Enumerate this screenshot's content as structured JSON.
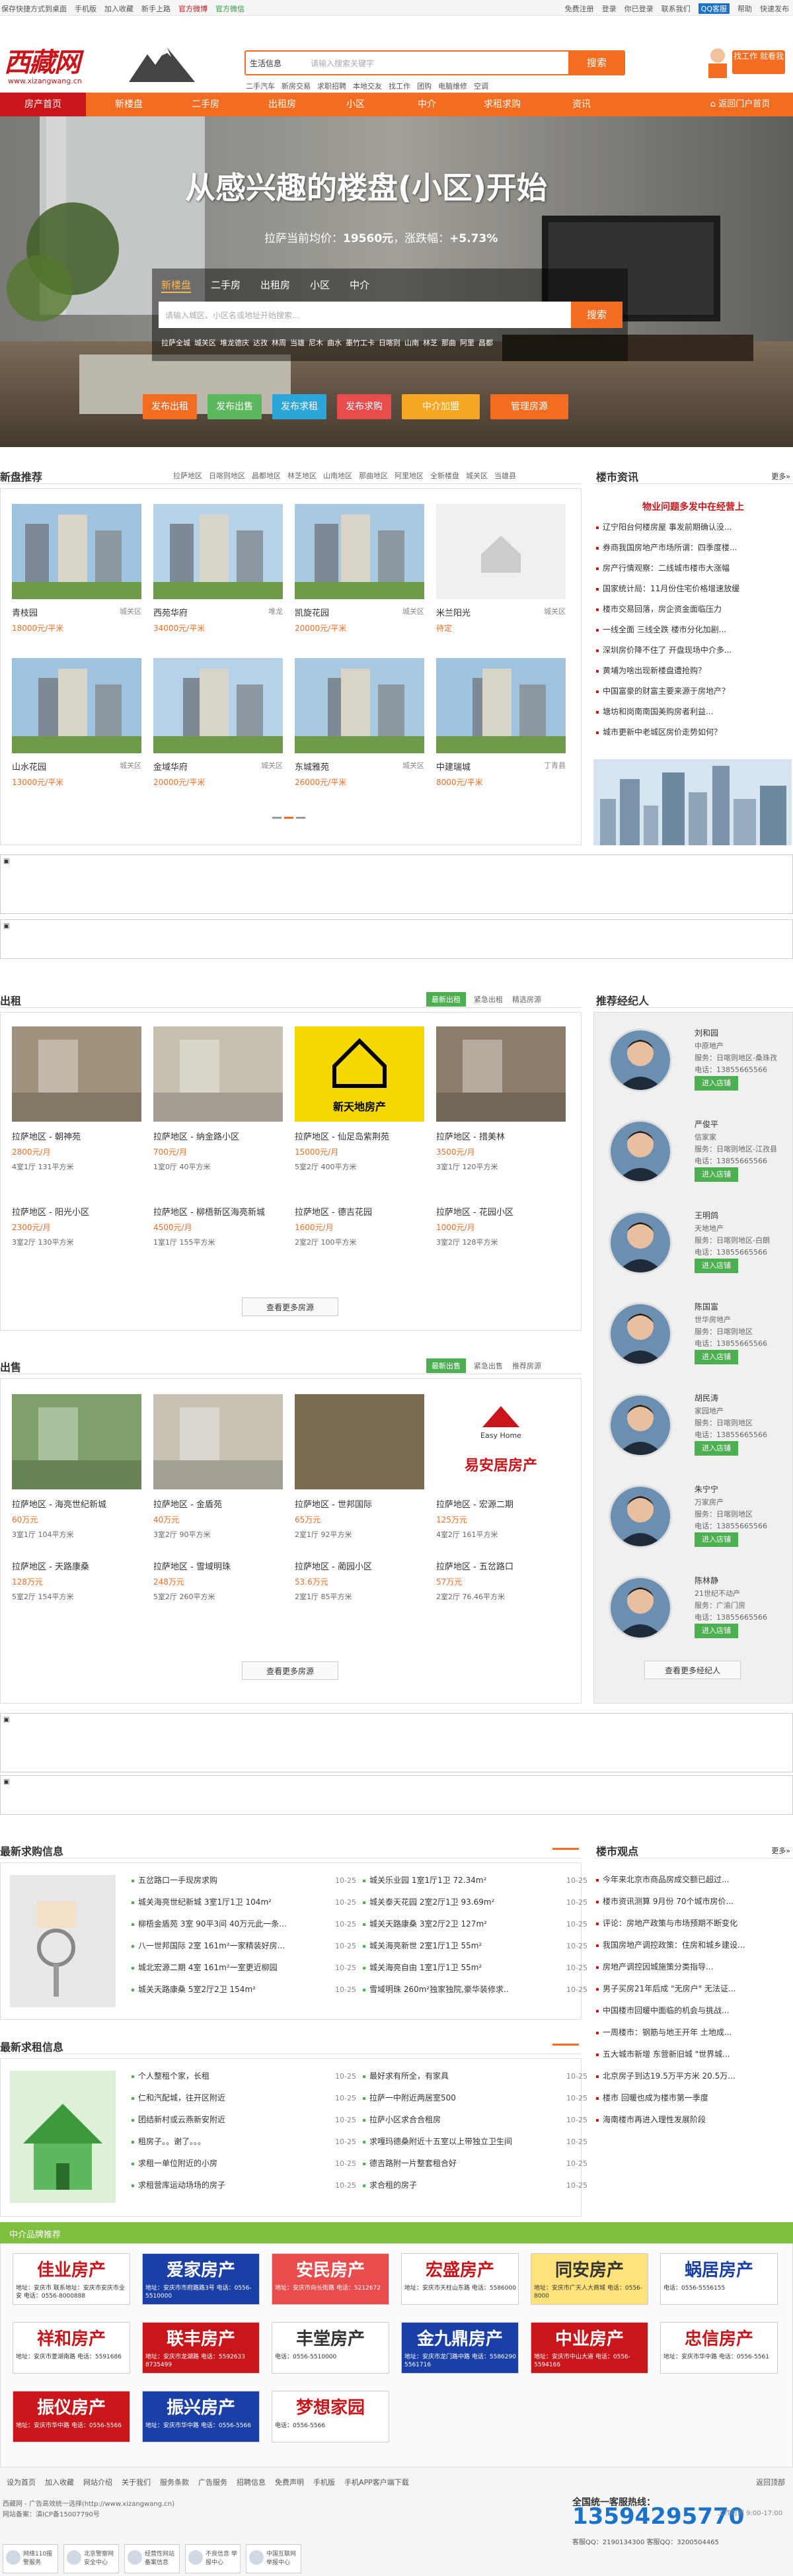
{
  "topbar": {
    "left": [
      "保存快捷方式到桌面",
      "手机版",
      "加入收藏",
      "新手上路",
      "官方微博",
      "官方微信"
    ],
    "right": [
      "免费注册",
      "登录",
      "你已登录",
      "联系我们",
      "QQ客服",
      "帮助",
      "快速发布"
    ]
  },
  "header": {
    "logo": "西藏网",
    "logo_sub": "www.xizangwang.cn",
    "search_category": "生活信息",
    "search_placeholder": "请输入搜索关键字",
    "search_button": "搜索",
    "hotlinks": [
      "二手汽车",
      "新房交易",
      "求职招聘",
      "本地交友",
      "找工作",
      "团购",
      "电脑维修",
      "空调"
    ],
    "promo": "找工作 就看我"
  },
  "nav": {
    "items": [
      "房产首页",
      "新楼盘",
      "二手房",
      "出租房",
      "小区",
      "中介",
      "求租求购",
      "资讯"
    ],
    "right": "返回门户首页"
  },
  "hero": {
    "title": "从感兴趣的楼盘(小区)开始",
    "price_text": "拉萨当前均价：",
    "price": "19560元",
    "rise_text": "，涨跌幅：",
    "rise": "+5.73%",
    "tabs": [
      "新楼盘",
      "二手房",
      "出租房",
      "小区",
      "中介"
    ],
    "input_placeholder": "请输入城区、小区名或地址开始搜索...",
    "search_button": "搜索",
    "areas": [
      "拉萨全城",
      "城关区",
      "堆龙德庆",
      "达孜",
      "林周",
      "当雄",
      "尼木",
      "曲水",
      "墨竹工卡",
      "日喀则",
      "山南",
      "林芝",
      "那曲",
      "阿里",
      "昌都"
    ],
    "buttons": [
      {
        "label": "发布出租",
        "color": "#f26d21"
      },
      {
        "label": "发布出售",
        "color": "#5cb85c"
      },
      {
        "label": "发布求租",
        "color": "#2aa7d8"
      },
      {
        "label": "发布求购",
        "color": "#e84c4c"
      },
      {
        "label": "中介加盟",
        "color": "#f5a623"
      },
      {
        "label": "管理房源",
        "color": "#f26d21"
      }
    ]
  },
  "newhouse": {
    "title": "新盘推荐",
    "tabs": [
      "拉萨地区",
      "日喀则地区",
      "昌都地区",
      "林芝地区",
      "山南地区",
      "那曲地区",
      "阿里地区",
      "全新楼盘",
      "城关区",
      "当雄县"
    ],
    "cards": [
      {
        "name": "青枝园",
        "area": "城关区",
        "price": "18000元/平米"
      },
      {
        "name": "西苑华府",
        "area": "堆龙",
        "price": "34000元/平米"
      },
      {
        "name": "凯旋花园",
        "area": "城关区",
        "price": "20000元/平米"
      },
      {
        "name": "米兰阳光",
        "area": "城关区",
        "price": "待定"
      },
      {
        "name": "山水花园",
        "area": "城关区",
        "price": "13000元/平米"
      },
      {
        "name": "金域华府",
        "area": "城关区",
        "price": "20000元/平米"
      },
      {
        "name": "东城雅苑",
        "area": "城关区",
        "price": "26000元/平米"
      },
      {
        "name": "中建瑞城",
        "area": "丁青县",
        "price": "8000元/平米"
      }
    ]
  },
  "news": {
    "title": "楼市资讯",
    "more": "更多»",
    "headline": "物业问题多发中在经营上",
    "items": [
      "辽宁阳台何楼房屋 事发前期确认没...",
      "券商我国房地产市场所谓：四季度楼...",
      "房产行情观察：二线城市楼市大涨幅",
      "国家统计局：11月份住宅价格增速放缓",
      "楼市交易回落，房企资金面临压力",
      "一线全面 三线全跌 楼市分化加剧...",
      "深圳房价降不住了 开盘现场中介多...",
      "黄埔为啥出现新楼盘遭抢购？",
      "中国富豪的财富主要来源于房地产？",
      "塘坊和岗南南国美购房者利益...",
      "城市更新中老城区房价走势如何？"
    ]
  },
  "rent": {
    "title": "出租",
    "tabs": [
      "最新出租",
      "紧急出租",
      "精选房源"
    ],
    "cards": [
      {
        "title": "拉萨地区 - 朝神苑",
        "price": "2800元/月",
        "detail": "4室1厅 131平方米"
      },
      {
        "title": "拉萨地区 - 纳金路小区",
        "price": "700元/月",
        "detail": "1室0厅 40平方米"
      },
      {
        "title": "拉萨地区 - 仙足岛紫荆苑",
        "price": "15000元/月",
        "detail": "5室2厅 400平方米"
      },
      {
        "title": "拉萨地区 - 措美林",
        "price": "3500元/月",
        "detail": "3室1厅 120平方米"
      },
      {
        "title": "拉萨地区 - 阳光小区",
        "price": "2300元/月",
        "detail": "3室2厅 130平方米"
      },
      {
        "title": "拉萨地区 - 柳梧新区海亮新城",
        "price": "4500元/月",
        "detail": "1室1厅 155平方米"
      },
      {
        "title": "拉萨地区 - 德吉花园",
        "price": "1600元/月",
        "detail": "2室2厅 100平方米"
      },
      {
        "title": "拉萨地区 - 花园小区",
        "price": "1000元/月",
        "detail": "3室2厅 128平方米"
      }
    ],
    "more": "查看更多房源",
    "logo": "新天地房产"
  },
  "sale": {
    "title": "出售",
    "tabs": [
      "最新出售",
      "紧急出售",
      "推荐房源"
    ],
    "cards": [
      {
        "title": "拉萨地区 - 海亮世纪新城",
        "price": "60万元",
        "detail": "3室1厅 104平方米"
      },
      {
        "title": "拉萨地区 - 金盾苑",
        "price": "40万元",
        "detail": "3室2厅 90平方米"
      },
      {
        "title": "拉萨地区 - 世邦国际",
        "price": "65万元",
        "detail": "2室1厅 92平方米"
      },
      {
        "title": "拉萨地区 - 宏源二期",
        "price": "125万元",
        "detail": "4室2厅 161平方米"
      },
      {
        "title": "拉萨地区 - 天路康桑",
        "price": "128万元",
        "detail": "5室2厅 154平方米"
      },
      {
        "title": "拉萨地区 - 雪域明珠",
        "price": "248万元",
        "detail": "5室2厅 260平方米"
      },
      {
        "title": "拉萨地区 - 蔺园小区",
        "price": "53.6万元",
        "detail": "2室1厅 85平方米"
      },
      {
        "title": "拉萨地区 - 五岔路口",
        "price": "57万元",
        "detail": "2室2厅 76.46平方米"
      }
    ],
    "more": "查看更多房源",
    "logo": "易安居房产",
    "logo_en": "Easy Home"
  },
  "agents": {
    "title": "推荐经纪人",
    "button": "进入店铺",
    "more": "查看更多经纪人",
    "list": [
      {
        "name": "刘和园",
        "company": "中原地产",
        "area": "服务：日喀则地区-桑珠孜",
        "phone": "电话：13855665566"
      },
      {
        "name": "严俊平",
        "company": "信家家",
        "area": "服务：日喀则地区-江孜县",
        "phone": "电话：13855665566"
      },
      {
        "name": "王明鸽",
        "company": "天地地产",
        "area": "服务：日喀则地区-白朗",
        "phone": "电话：13855665566"
      },
      {
        "name": "陈国富",
        "company": "世华房地产",
        "area": "服务：日喀则地区",
        "phone": "电话：13855665566"
      },
      {
        "name": "胡民涛",
        "company": "家园地产",
        "area": "服务：日喀则地区",
        "phone": "电话：13855665566"
      },
      {
        "name": "朱宁宁",
        "company": "万家房产",
        "area": "服务：日喀则地区",
        "phone": "电话：13855665566"
      },
      {
        "name": "陈林静",
        "company": "21世纪不动产",
        "area": "服务：广渝门房",
        "phone": "电话：13855665566"
      }
    ]
  },
  "buy": {
    "title": "最新求购信息",
    "left": [
      {
        "t": "五岔路口一手现房求购",
        "d": "10-25"
      },
      {
        "t": "城关海亮世纪新城 3室1厅1卫 104m²",
        "d": "10-25"
      },
      {
        "t": "柳梧金盾苑 3室 90平3间 40万元此一条...",
        "d": "10-25"
      },
      {
        "t": "八一世邦国际 2室 161m²一家精装好房...",
        "d": "10-25"
      },
      {
        "t": "城北宏源二期 4室 161m²一室更近柳园 ",
        "d": "10-25"
      },
      {
        "t": "城关天路康桑 5室2厅2卫 154m²",
        "d": "10-25"
      }
    ],
    "right": [
      {
        "t": "城关乐业园 1室1厅1卫 72.34m²",
        "d": "10-25"
      },
      {
        "t": "城关泰天花园 2室2厅1卫 93.69m²",
        "d": "10-25"
      },
      {
        "t": "城关天路康桑 3室2厅2卫 127m²",
        "d": "10-25"
      },
      {
        "t": "城关海亮新世 2室1厅1卫 55m²",
        "d": "10-25"
      },
      {
        "t": "城关海亮自由 1室1厅1卫 55m²",
        "d": "10-25"
      },
      {
        "t": "雪域明珠 260m²独家独院,豪华装修求..",
        "d": "10-25"
      }
    ]
  },
  "view": {
    "title": "楼市观点",
    "more": "更多»",
    "items": [
      "今年来北京市商品房成交额已超过...",
      "楼市资讯测算 9月份 70个城市房价...",
      "评论：房地产政策与市场预期不断变化",
      "我国房地产调控政策：住房和城乡建设...",
      "房地产调控因城施策分类指导...",
      "男子买房21年后成 \"无房户\" 无法证...",
      "中国楼市回暖中面临的机会与挑战...",
      "一周楼市：钢筋与地王开年 土地成...",
      "五大城市新增 东营新旧城 \"世界城...",
      "北京房子到达19.5万平方米 20.5万...",
      "楼市 回暖也成为楼市第一季度",
      "海南楼市再进入理性发展阶段"
    ]
  },
  "rentreq": {
    "title": "最新求租信息",
    "left": [
      {
        "t": "个人整租个家，长租",
        "d": "10-25"
      },
      {
        "t": "仁和汽配城，往开区附近",
        "d": "10-25"
      },
      {
        "t": "团结新村或云燕新安附近",
        "d": "10-25"
      },
      {
        "t": "租房子。。谢了。。。",
        "d": "10-25"
      },
      {
        "t": "求租一单位附近的小房",
        "d": "10-25"
      },
      {
        "t": "求租营库运动场场的房子",
        "d": "10-25"
      }
    ],
    "right": [
      {
        "t": "最好求有所全，有家具",
        "d": "10-25"
      },
      {
        "t": "拉萨一中附近两居室500",
        "d": "10-25"
      },
      {
        "t": "拉萨小区求合合租房",
        "d": "10-25"
      },
      {
        "t": "求嘎玛德桑附近十五室以上带独立卫生间",
        "d": "10-25"
      },
      {
        "t": "德吉路附一片整套租合好",
        "d": "10-25"
      },
      {
        "t": "求合租的房子",
        "d": "10-25"
      }
    ]
  },
  "brands": {
    "title": "中介品牌推荐",
    "list": [
      {
        "name": "佳业房产",
        "color": "#c9161b",
        "bg": "#fff",
        "info": "地址：安庆市 联系地址：安庆市安庆市业安 电话：0556-8000888"
      },
      {
        "name": "爱家房产",
        "color": "#fff",
        "bg": "#1a3fa6",
        "info": "地址：安庆市市府路路3号 电话：0556-5510000"
      },
      {
        "name": "安民房产",
        "color": "#fff",
        "bg": "#e84c4c",
        "info": "地址：安庆市向长街路 电话：5212672"
      },
      {
        "name": "宏盛房产",
        "color": "#c9161b",
        "bg": "#fff",
        "info": "地址：安庆市天柱山东路 电话：5586000"
      },
      {
        "name": "同安房产",
        "color": "#333",
        "bg": "#ffe37a",
        "info": "地址：安庆市广天人大商城 电话：0556-8000"
      },
      {
        "name": "蜗居房产",
        "color": "#1a3fa6",
        "bg": "#fff",
        "info": "电话：0556-5556155"
      },
      {
        "name": "祥和房产",
        "color": "#c9161b",
        "bg": "#fff",
        "info": "地址：安庆市菱湖南路 电话：5591686"
      },
      {
        "name": "联丰房产",
        "color": "#fff",
        "bg": "#c9161b",
        "info": "地址：安庆市龙湖路 电话：5592633 8735499"
      },
      {
        "name": "丰堂房产",
        "color": "#333",
        "bg": "#fff",
        "info": "电话：0556-5510000"
      },
      {
        "name": "金九鼎房产",
        "color": "#fff",
        "bg": "#1a3fa6",
        "info": "地址：安庆市龙门路中路 电话：5586290 5561716"
      },
      {
        "name": "中业房产",
        "color": "#fff",
        "bg": "#c9161b",
        "info": "地址：安庆市中山大道 电话：0556-5594166"
      },
      {
        "name": "忠信房产",
        "color": "#c9161b",
        "bg": "#fff",
        "info": "地址：安庆市华中路 电话：0556-5561"
      },
      {
        "name": "振仪房产",
        "color": "#fff",
        "bg": "#c9161b",
        "info": "地址：安庆市华中路 电话：0556-5566"
      },
      {
        "name": "振兴房产",
        "color": "#fff",
        "bg": "#1a3fa6",
        "info": "地址：安庆市华中路 电话：0556-5566"
      },
      {
        "name": "梦想家园",
        "color": "#c9161b",
        "bg": "#fff",
        "info": "电话：0556-5566"
      }
    ]
  },
  "footer": {
    "links": [
      "设为首页",
      "加入收藏",
      "网站介绍",
      "关于我们",
      "服务条款",
      "广告服务",
      "招聘信息",
      "免费声明",
      "手机版",
      "手机APP客户端下载"
    ],
    "top": "返回顶部",
    "note1": "西藏网 - 广告高效统一选择(http://www.xizangwang.cn)",
    "note2": "网站备案：滇ICP备15007790号",
    "phone_title": "全国统一客服热线：",
    "phone": "13594295770",
    "hours": "工作时间 9:00-17:00",
    "qq": "客服QQ：2190134300    客服QQ：3200504465",
    "badges": [
      "网络110报警服务",
      "北京警察网 安全中心",
      "经营性网站 备案信息",
      "不良信息 举报中心",
      "中国互联网 举报中心"
    ]
  }
}
